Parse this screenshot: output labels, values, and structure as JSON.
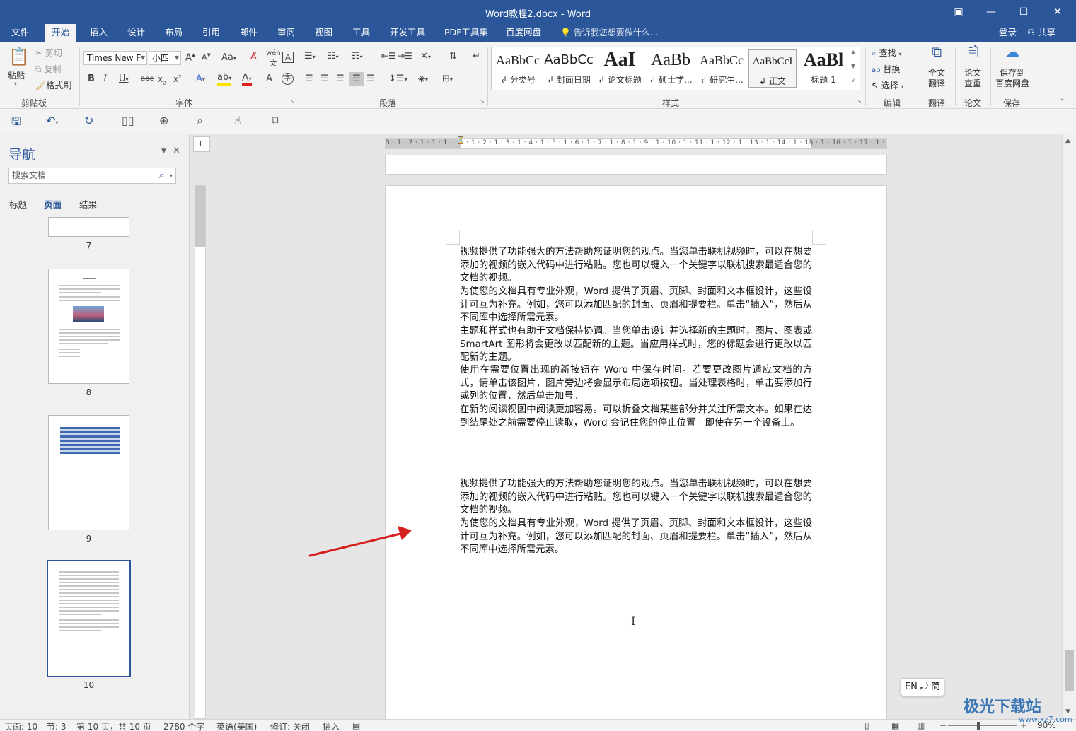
{
  "window": {
    "title": "Word教程2.docx - Word",
    "controls": [
      "▣",
      "—",
      "☐",
      "✕"
    ]
  },
  "menu": {
    "tabs": [
      "文件",
      "开始",
      "插入",
      "设计",
      "布局",
      "引用",
      "邮件",
      "审阅",
      "视图",
      "工具",
      "开发工具",
      "PDF工具集",
      "百度网盘"
    ],
    "active_tab": "开始",
    "tell_me": "告诉我您想要做什么...",
    "login": "登录",
    "share": "共享"
  },
  "ribbon": {
    "clipboard": {
      "paste": "粘贴",
      "cut": "剪切",
      "copy": "复制",
      "format_painter": "格式刷",
      "label": "剪贴板"
    },
    "font": {
      "name": "Times New F",
      "size": "小四",
      "case": "Aa",
      "label": "字体"
    },
    "paragraph": {
      "label": "段落"
    },
    "styles": {
      "label": "样式",
      "items": [
        {
          "sample": "AaBbCc",
          "name": "分类号"
        },
        {
          "sample": "AaBbCc",
          "name": "封面日期"
        },
        {
          "sample": "AaI",
          "name": "论文标题"
        },
        {
          "sample": "AaBb",
          "name": "硕士学..."
        },
        {
          "sample": "AaBbCc",
          "name": "研究生..."
        },
        {
          "sample": "AaBbCcI",
          "name": "正文"
        },
        {
          "sample": "AaBl",
          "name": "标题 1"
        }
      ],
      "selected": "正文"
    },
    "editing": {
      "find": "查找",
      "replace": "替换",
      "select": "选择",
      "label": "编辑"
    },
    "translate": {
      "full": "全文\n翻译",
      "label": "翻译"
    },
    "paper": {
      "check": "论文\n查重",
      "label": "论文"
    },
    "save": {
      "baidu": "保存到\n百度网盘",
      "label": "保存"
    }
  },
  "nav_pane": {
    "title": "导航",
    "search_placeholder": "搜索文档",
    "tabs": [
      "标题",
      "页面",
      "结果"
    ],
    "active_tab": "页面",
    "pages": [
      "7",
      "8",
      "9",
      "10"
    ],
    "selected_page": "10"
  },
  "ruler": {
    "horizontal": "3 · 1 · 2 · 1 · 1 · 1 ·  · 1 · 1 · 2 · 1 · 3 · 1 · 4 · 1 · 5 · 1 · 6 · 1 · 7 · 1 · 8 · 1 · 9 · 1 · 10 · 1 · 11 · 1 · 12 · 1 · 13 · 1 · 14 · 1 · 15 · 1 · 16 · 1 · 17 · 1 ·",
    "tab_selector": "L"
  },
  "document": {
    "paragraphs_block1": [
      "视频提供了功能强大的方法帮助您证明您的观点。当您单击联机视频时，可以在想要添加的视频的嵌入代码中进行粘贴。您也可以键入一个关键字以联机搜索最适合您的文档的视频。",
      "为使您的文档具有专业外观，Word 提供了页眉、页脚、封面和文本框设计，这些设计可互为补充。例如，您可以添加匹配的封面、页眉和提要栏。单击“插入”，然后从不同库中选择所需元素。",
      "主题和样式也有助于文档保持协调。当您单击设计并选择新的主题时，图片、图表或 SmartArt 图形将会更改以匹配新的主题。当应用样式时，您的标题会进行更改以匹配新的主题。",
      "使用在需要位置出现的新按钮在 Word 中保存时间。若要更改图片适应文档的方式，请单击该图片，图片旁边将会显示布局选项按钮。当处理表格时，单击要添加行或列的位置，然后单击加号。",
      "在新的阅读视图中阅读更加容易。可以折叠文档某些部分并关注所需文本。如果在达到结尾处之前需要停止读取，Word 会记住您的停止位置 - 即使在另一个设备上。"
    ],
    "paragraphs_block2": [
      "视频提供了功能强大的方法帮助您证明您的观点。当您单击联机视频时，可以在想要添加的视频的嵌入代码中进行粘贴。您也可以键入一个关键字以联机搜索最适合您的文档的视频。",
      "为使您的文档具有专业外观，Word 提供了页眉、页脚、封面和文本框设计，这些设计可互为补充。例如，您可以添加匹配的封面、页眉和提要栏。单击“插入”，然后从不同库中选择所需元素。"
    ]
  },
  "ime": "EN ⤾ 简",
  "status": {
    "page": "页面: 10",
    "section": "节: 3",
    "page_of": "第 10 页，共 10 页",
    "words": "2780 个字",
    "language": "英语(美国)",
    "track": "修订: 关闭",
    "mode": "插入",
    "zoom": "90%"
  },
  "watermark": {
    "main": "极光下载站",
    "sub": "www.xz7.com"
  },
  "colors": {
    "accent": "#2b579a",
    "arrow": "#d62020"
  }
}
